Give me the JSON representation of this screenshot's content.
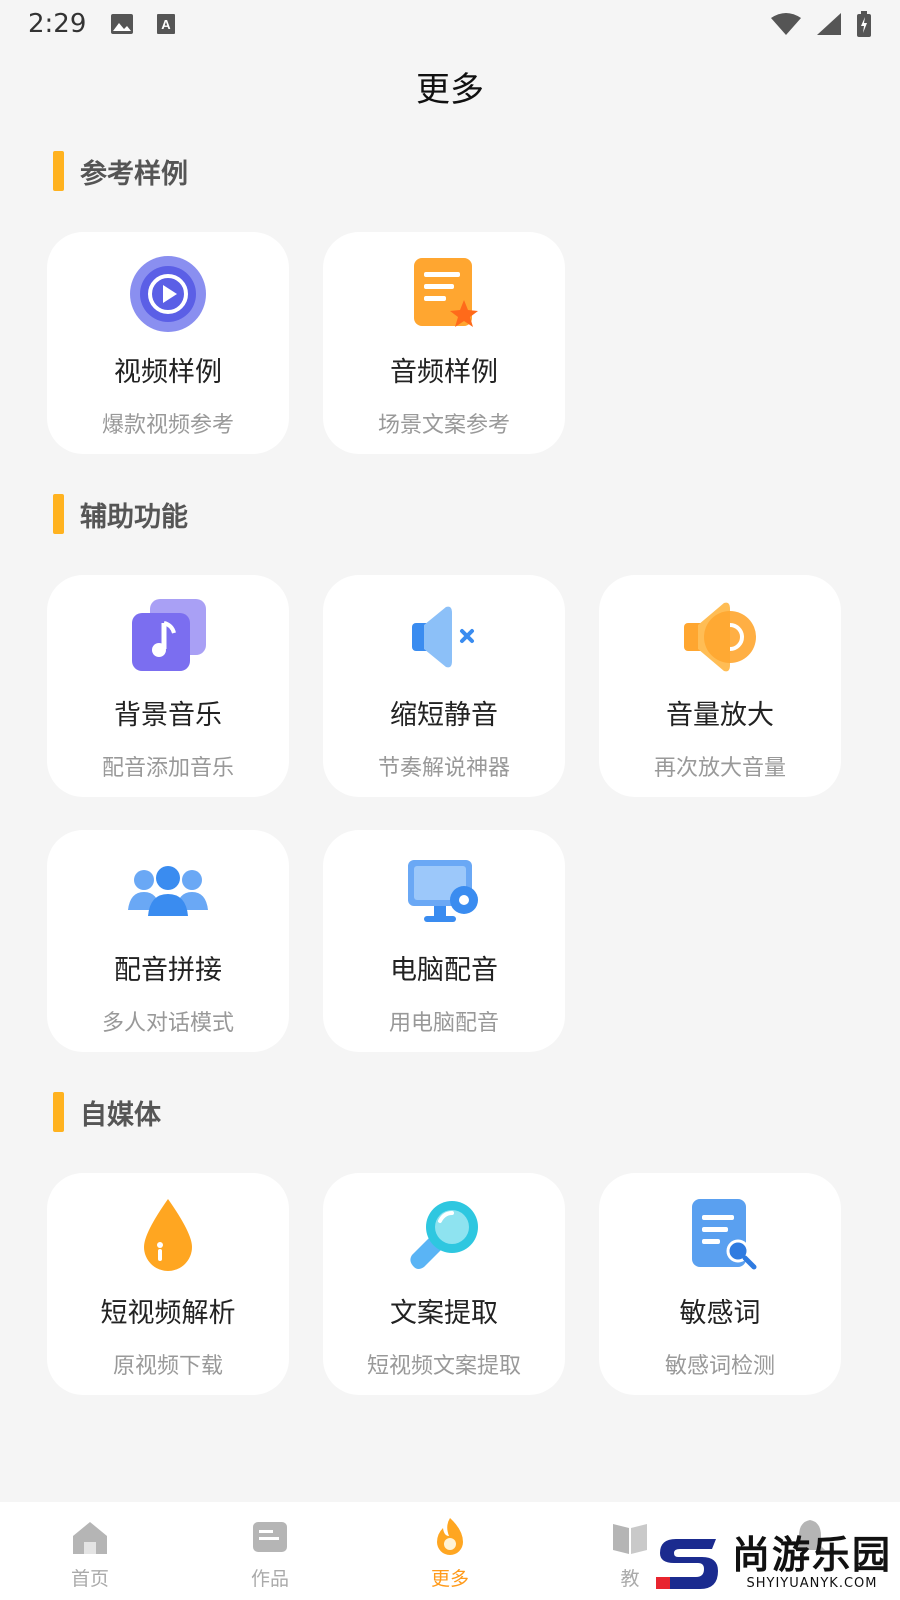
{
  "status_bar": {
    "time": "2:29",
    "icons": [
      "image-icon",
      "a-icon",
      "wifi-icon",
      "signal-icon",
      "battery-icon"
    ]
  },
  "page": {
    "title": "更多"
  },
  "sections": [
    {
      "title": "参考样例",
      "items": [
        {
          "title": "视频样例",
          "subtitle": "爆款视频参考",
          "icon": "play-circle-icon"
        },
        {
          "title": "音频样例",
          "subtitle": "场景文案参考",
          "icon": "document-star-icon"
        }
      ]
    },
    {
      "title": "辅助功能",
      "items": [
        {
          "title": "背景音乐",
          "subtitle": "配音添加音乐",
          "icon": "music-note-icon"
        },
        {
          "title": "缩短静音",
          "subtitle": "节奏解说神器",
          "icon": "speaker-mute-icon"
        },
        {
          "title": "音量放大",
          "subtitle": "再次放大音量",
          "icon": "speaker-loud-icon"
        },
        {
          "title": "配音拼接",
          "subtitle": "多人对话模式",
          "icon": "group-people-icon"
        },
        {
          "title": "电脑配音",
          "subtitle": "用电脑配音",
          "icon": "computer-gear-icon"
        }
      ]
    },
    {
      "title": "自媒体",
      "items": [
        {
          "title": "短视频解析",
          "subtitle": "原视频下载",
          "icon": "water-drop-icon"
        },
        {
          "title": "文案提取",
          "subtitle": "短视频文案提取",
          "icon": "magnifier-icon"
        },
        {
          "title": "敏感词",
          "subtitle": "敏感词检测",
          "icon": "document-search-icon"
        }
      ]
    }
  ],
  "tab_bar": {
    "tabs": [
      {
        "label": "首页",
        "icon": "home-icon",
        "active": false
      },
      {
        "label": "作品",
        "icon": "works-icon",
        "active": false
      },
      {
        "label": "更多",
        "icon": "flame-icon",
        "active": true
      },
      {
        "label": "教",
        "icon": "tutorial-icon",
        "active": false
      },
      {
        "label": "",
        "icon": "bell-icon",
        "active": false
      }
    ]
  },
  "watermark": {
    "logo_text": "尚游乐园",
    "logo_url_text": "SHYIYUANYK.COM"
  },
  "colors": {
    "accent": "#ffb21f",
    "active_tab": "#ff9a1a",
    "background": "#f5f5f5"
  }
}
